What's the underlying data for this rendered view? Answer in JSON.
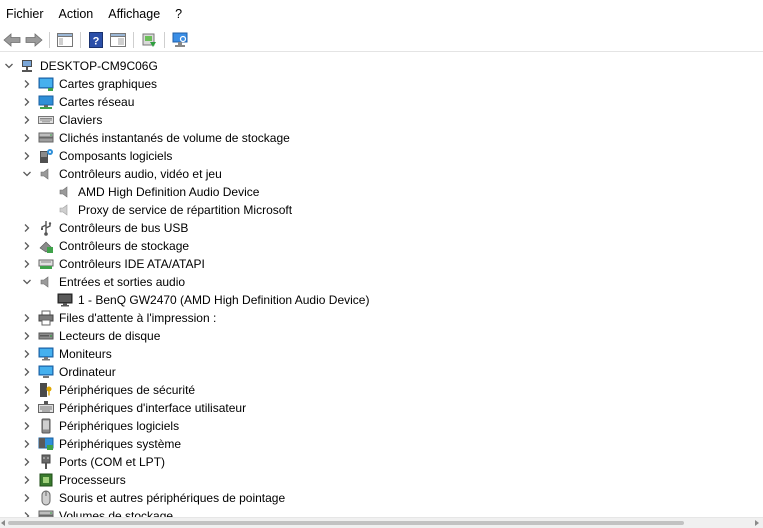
{
  "menubar": {
    "items": [
      "Fichier",
      "Action",
      "Affichage",
      "?"
    ]
  },
  "toolbar": {
    "buttons": [
      "back-arrow-icon",
      "forward-arrow-icon",
      "console-tree-icon",
      "help-icon",
      "properties-icon",
      "update-driver-icon",
      "scan-hardware-icon"
    ]
  },
  "tree": {
    "root": "DESKTOP-CM9C06G",
    "nodes": [
      {
        "label": "Cartes graphiques",
        "icon": "display-adapter-icon",
        "expanded": false
      },
      {
        "label": "Cartes réseau",
        "icon": "network-adapter-icon",
        "expanded": false
      },
      {
        "label": "Claviers",
        "icon": "keyboard-icon",
        "expanded": false
      },
      {
        "label": "Clichés instantanés de volume de stockage",
        "icon": "storage-volume-icon",
        "expanded": false
      },
      {
        "label": "Composants logiciels",
        "icon": "software-component-icon",
        "expanded": false
      },
      {
        "label": "Contrôleurs audio, vidéo et jeu",
        "icon": "speaker-icon",
        "expanded": true,
        "children": [
          "AMD High Definition Audio Device",
          "Proxy de service de répartition Microsoft"
        ]
      },
      {
        "label": "Contrôleurs de bus USB",
        "icon": "usb-icon",
        "expanded": false
      },
      {
        "label": "Contrôleurs de stockage",
        "icon": "storage-controller-icon",
        "expanded": false
      },
      {
        "label": "Contrôleurs IDE ATA/ATAPI",
        "icon": "ide-controller-icon",
        "expanded": false
      },
      {
        "label": "Entrées et sorties audio",
        "icon": "speaker-icon",
        "expanded": true,
        "children": [
          "1 - BenQ GW2470 (AMD High Definition Audio Device)"
        ]
      },
      {
        "label": "Files d'attente à l'impression :",
        "icon": "printer-icon",
        "expanded": false
      },
      {
        "label": "Lecteurs de disque",
        "icon": "disk-drive-icon",
        "expanded": false
      },
      {
        "label": "Moniteurs",
        "icon": "monitor-icon",
        "expanded": false
      },
      {
        "label": "Ordinateur",
        "icon": "computer-icon",
        "expanded": false
      },
      {
        "label": "Périphériques de sécurité",
        "icon": "security-device-icon",
        "expanded": false
      },
      {
        "label": "Périphériques d'interface utilisateur",
        "icon": "hid-icon",
        "expanded": false
      },
      {
        "label": "Périphériques logiciels",
        "icon": "software-device-icon",
        "expanded": false
      },
      {
        "label": "Périphériques système",
        "icon": "system-device-icon",
        "expanded": false
      },
      {
        "label": "Ports (COM et LPT)",
        "icon": "port-icon",
        "expanded": false
      },
      {
        "label": "Processeurs",
        "icon": "processor-icon",
        "expanded": false
      },
      {
        "label": "Souris et autres périphériques de pointage",
        "icon": "mouse-icon",
        "expanded": false
      },
      {
        "label": "Volumes de stockage",
        "icon": "storage-volume-icon",
        "expanded": false
      }
    ]
  },
  "colors": {
    "accent": "#1e7fd8",
    "chevron": "#5a5a5a",
    "icon_grey": "#6b6b6b"
  }
}
